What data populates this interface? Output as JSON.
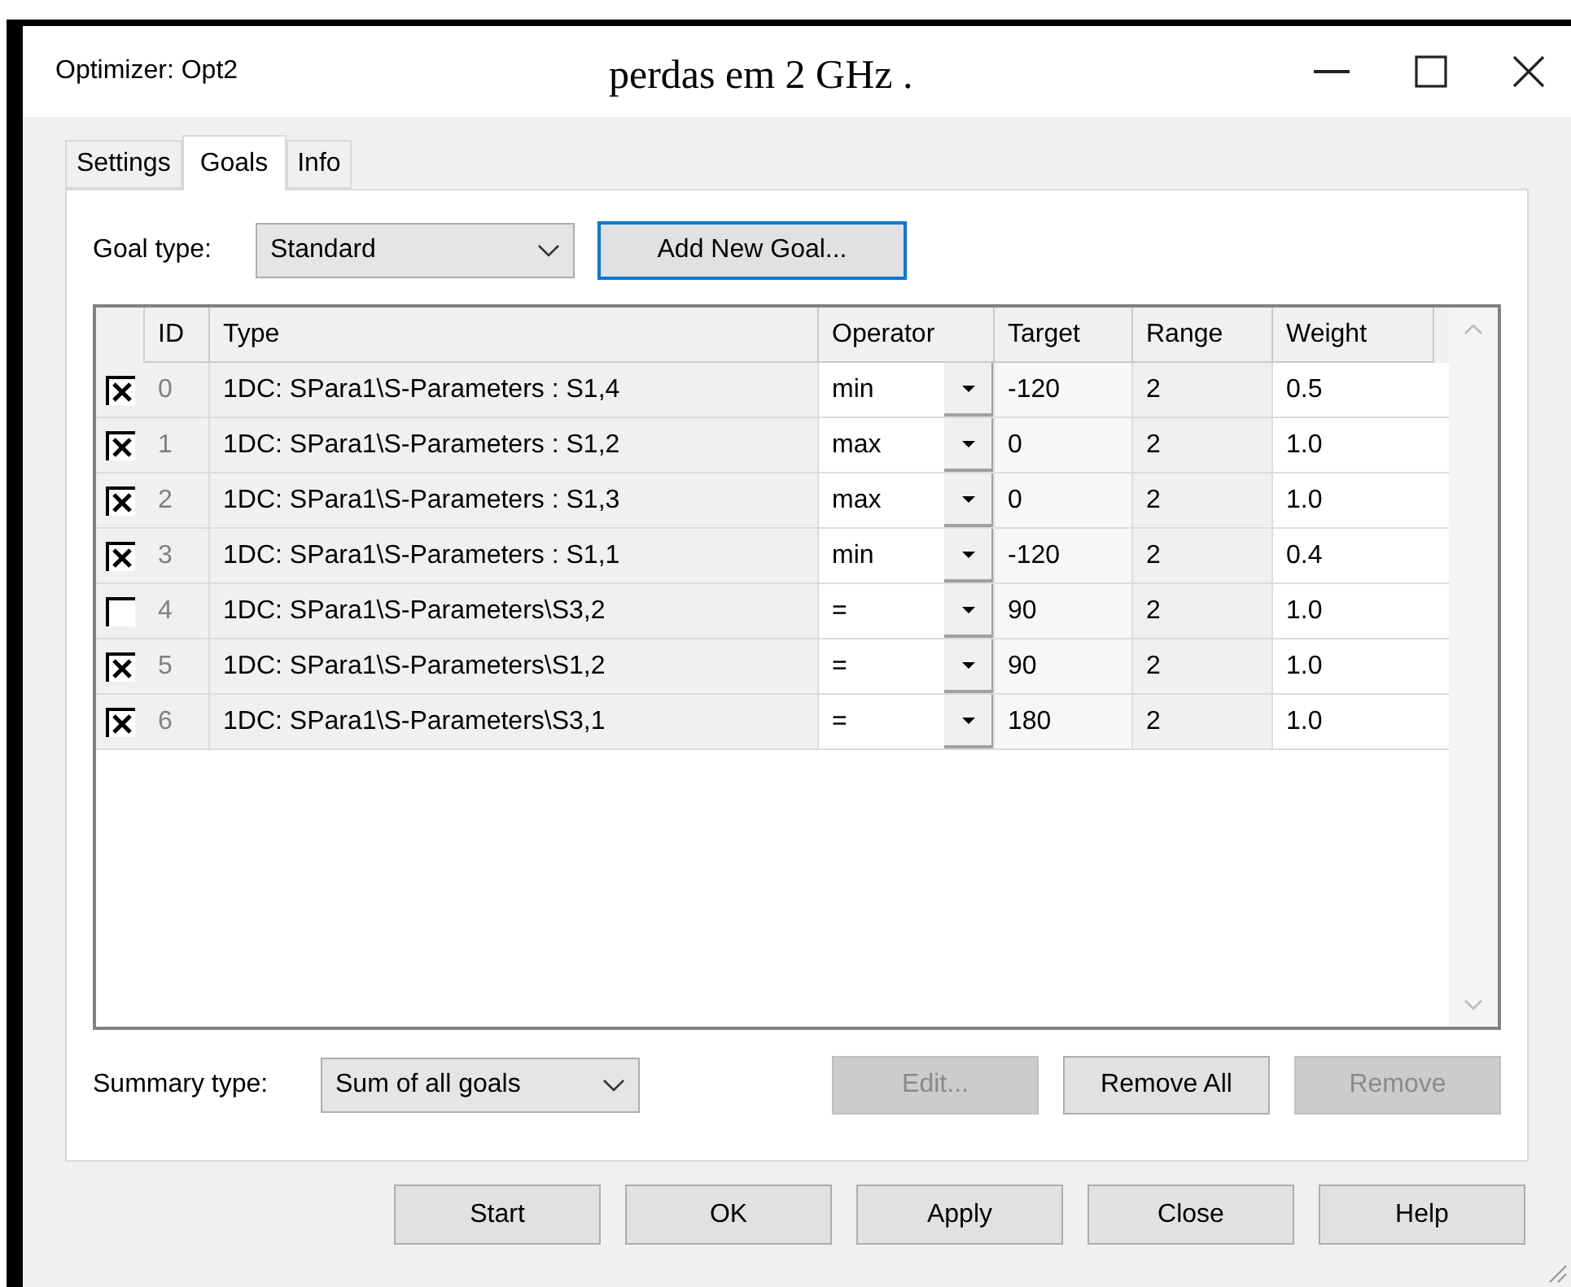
{
  "window": {
    "title": "Optimizer: Opt2"
  },
  "overlay_text": "perdas em 2 GHz .",
  "tabs": [
    {
      "label": "Settings",
      "selected": false
    },
    {
      "label": "Goals",
      "selected": true
    },
    {
      "label": "Info",
      "selected": false
    }
  ],
  "goal_type": {
    "label": "Goal type:",
    "value": "Standard"
  },
  "add_button": "Add New Goal...",
  "table": {
    "columns": [
      "ID",
      "Type",
      "Operator",
      "Target",
      "Range",
      "Weight"
    ],
    "rows": [
      {
        "checked": true,
        "id": "0",
        "type": "1DC: SPara1\\S-Parameters : S1,4",
        "operator": "min",
        "target": "-120",
        "range": "2",
        "weight": "0.5"
      },
      {
        "checked": true,
        "id": "1",
        "type": "1DC: SPara1\\S-Parameters : S1,2",
        "operator": "max",
        "target": "0",
        "range": "2",
        "weight": "1.0"
      },
      {
        "checked": true,
        "id": "2",
        "type": "1DC: SPara1\\S-Parameters : S1,3",
        "operator": "max",
        "target": "0",
        "range": "2",
        "weight": "1.0"
      },
      {
        "checked": true,
        "id": "3",
        "type": "1DC: SPara1\\S-Parameters : S1,1",
        "operator": "min",
        "target": "-120",
        "range": "2",
        "weight": "0.4"
      },
      {
        "checked": false,
        "id": "4",
        "type": "1DC: SPara1\\S-Parameters\\S3,2",
        "operator": "=",
        "target": "90",
        "range": "2",
        "weight": "1.0"
      },
      {
        "checked": true,
        "id": "5",
        "type": "1DC: SPara1\\S-Parameters\\S1,2",
        "operator": "=",
        "target": "90",
        "range": "2",
        "weight": "1.0"
      },
      {
        "checked": true,
        "id": "6",
        "type": "1DC: SPara1\\S-Parameters\\S3,1",
        "operator": "=",
        "target": "180",
        "range": "2",
        "weight": "1.0"
      }
    ]
  },
  "summary_type": {
    "label": "Summary type:",
    "value": "Sum of all goals"
  },
  "table_buttons": [
    {
      "label": "Edit...",
      "disabled": true
    },
    {
      "label": "Remove All",
      "disabled": false
    },
    {
      "label": "Remove",
      "disabled": true
    }
  ],
  "dialog_buttons": [
    "Start",
    "OK",
    "Apply",
    "Close",
    "Help"
  ]
}
